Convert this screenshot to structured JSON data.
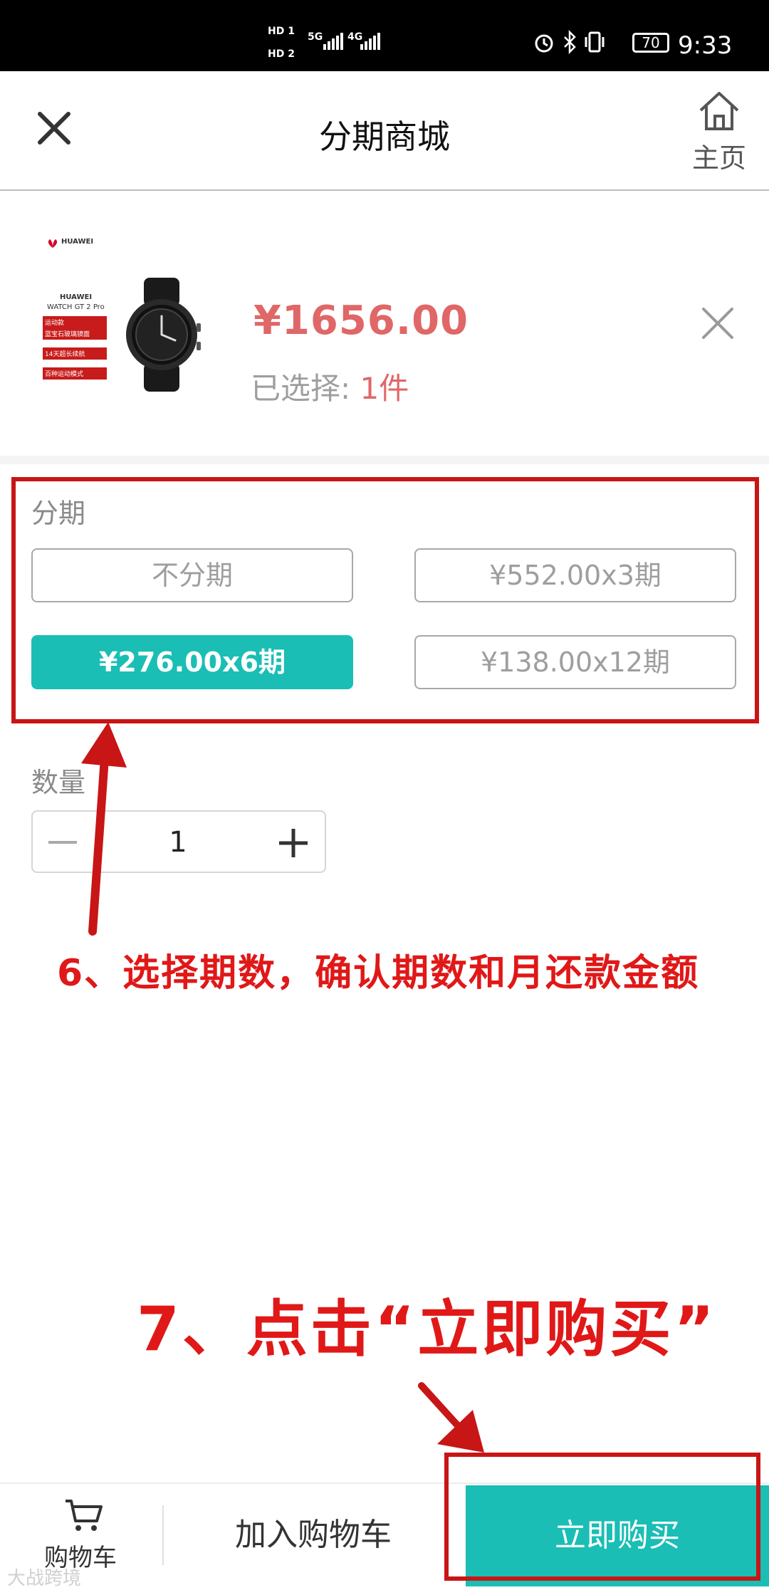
{
  "status_bar": {
    "sim1": "HD 1",
    "sim2": "HD 2",
    "net1": "5G",
    "net2": "4G",
    "battery": "70",
    "time": "9:33"
  },
  "header": {
    "title": "分期商城",
    "home_label": "主页"
  },
  "product": {
    "brand_text": "HUAWEI",
    "model_text": "WATCH GT 2 Pro",
    "promo_tags": [
      "运动款",
      "蓝宝石玻璃镜面",
      "14天超长续航",
      "百种运动模式"
    ],
    "price": "¥1656.00",
    "selected_label": "已选择: ",
    "selected_value": "1件"
  },
  "installments": {
    "label": "分期",
    "options": [
      "不分期",
      "¥552.00x3期",
      "¥276.00x6期",
      "¥138.00x12期"
    ],
    "selected_index": 2
  },
  "quantity": {
    "label": "数量",
    "value": "1"
  },
  "annotations": {
    "step6": "6、选择期数，确认期数和月还款金额",
    "step7": "7、点击“立即购买”"
  },
  "bottom_bar": {
    "cart_label": "购物车",
    "add_to_cart": "加入购物车",
    "buy_now": "立即购买"
  },
  "watermark": "大战跨境",
  "colors": {
    "accent": "#1abeb4",
    "price_red": "#e06767",
    "annotation_red": "#e01818"
  }
}
